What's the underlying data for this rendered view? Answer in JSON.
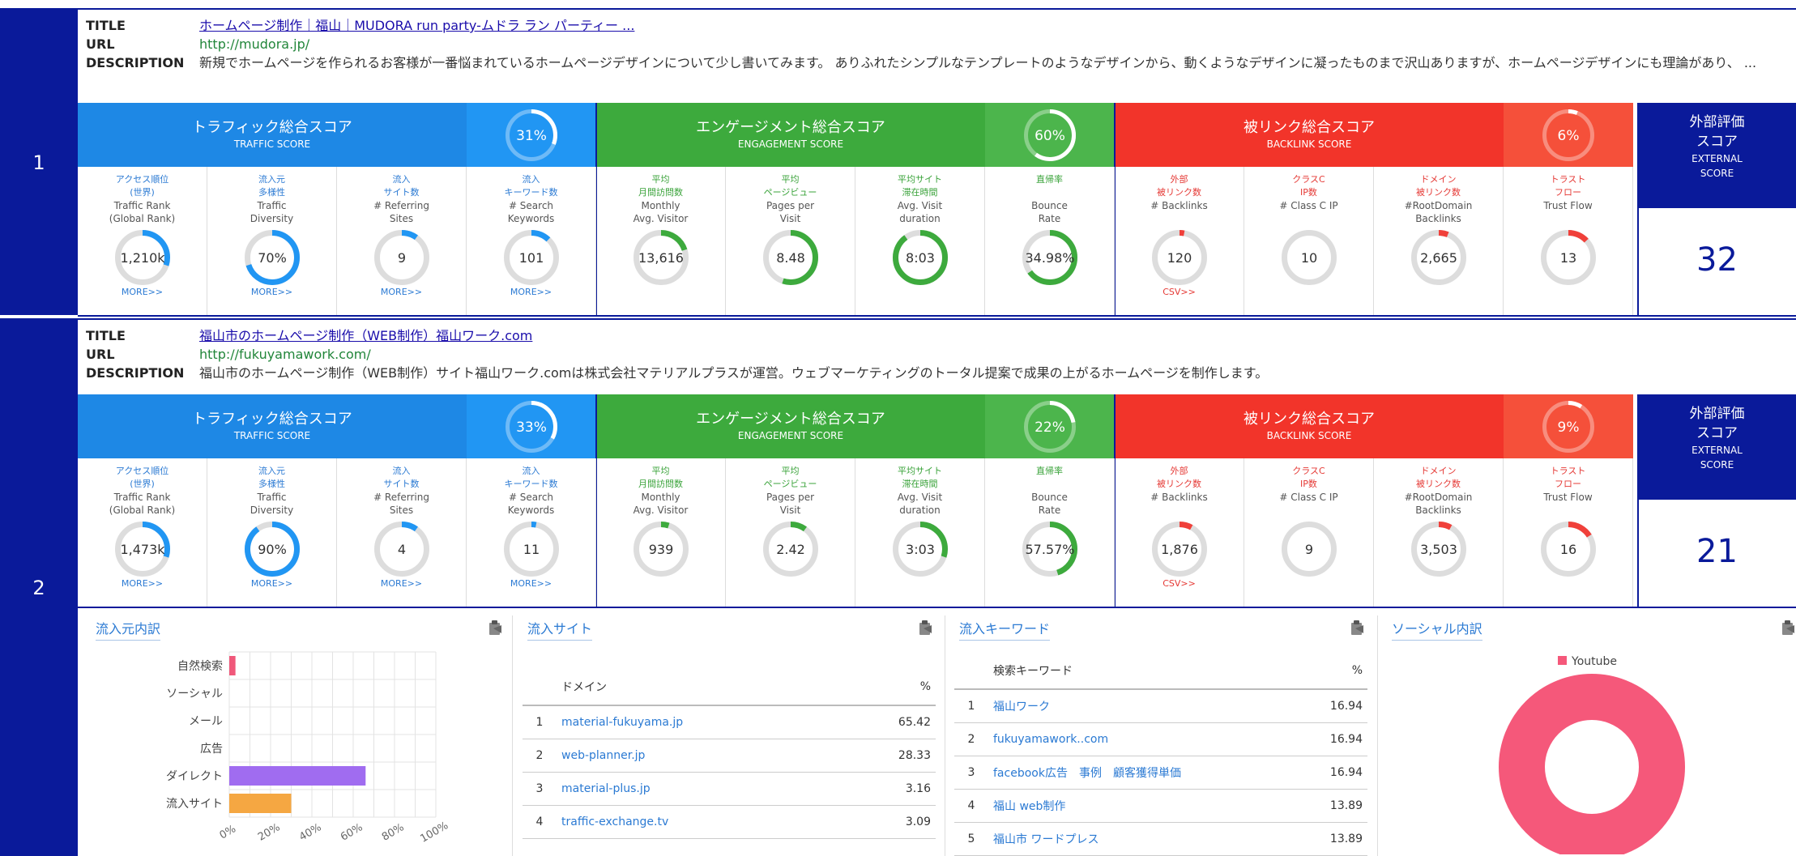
{
  "labels": {
    "title": "TITLE",
    "url": "URL",
    "description": "DESCRIPTION",
    "more": "MORE>>",
    "csv": "CSV>>"
  },
  "bands": {
    "traffic": {
      "jp": "トラフィック総合スコア",
      "en": "TRAFFIC SCORE",
      "color": "#1e88e5",
      "gauge_color": "#2196f3"
    },
    "engagement": {
      "jp": "エンゲージメント総合スコア",
      "en": "ENGAGEMENT SCORE",
      "color": "#3daa3d",
      "gauge_color": "#4cb54c"
    },
    "backlink": {
      "jp": "被リンク総合スコア",
      "en": "BACKLINK SCORE",
      "color": "#f2342a",
      "gauge_color": "#f5503a"
    }
  },
  "metric_labels": [
    {
      "jp": "アクセス順位\n(世界)",
      "en": "Traffic Rank\n(Global Rank)",
      "group": "traffic"
    },
    {
      "jp": "流入元\n多様性",
      "en": "Traffic\nDiversity",
      "group": "traffic"
    },
    {
      "jp": "流入\nサイト数",
      "en": "# Referring\nSites",
      "group": "traffic"
    },
    {
      "jp": "流入\nキーワード数",
      "en": "# Search\nKeywords",
      "group": "traffic"
    },
    {
      "jp": "平均\n月間訪問数",
      "en": "Monthly\nAvg. Visitor",
      "group": "engagement"
    },
    {
      "jp": "平均\nページビュー",
      "en": "Pages per\nVisit",
      "group": "engagement"
    },
    {
      "jp": "平均サイト\n滞在時間",
      "en": "Avg. Visit\nduration",
      "group": "engagement"
    },
    {
      "jp": "直帰率",
      "en": "Bounce\nRate",
      "group": "engagement"
    },
    {
      "jp": "外部\n被リンク数",
      "en": "# Backlinks",
      "group": "backlink"
    },
    {
      "jp": "クラスC\nIP数",
      "en": "# Class C IP",
      "group": "backlink"
    },
    {
      "jp": "ドメイン\n被リンク数",
      "en": "#RootDomain\nBacklinks",
      "group": "backlink"
    },
    {
      "jp": "トラスト\nフロー",
      "en": "Trust Flow",
      "group": "backlink"
    }
  ],
  "external": {
    "jp1": "外部評価",
    "jp2": "スコア",
    "en1": "EXTERNAL",
    "en2": "SCORE"
  },
  "sites": [
    {
      "rank": "1",
      "title": "ホームページ制作｜福山｜MUDORA run party-ムドラ ラン パーティー ...",
      "url": "http://mudora.jp/",
      "description": "新規でホームページを作られるお客様が一番悩まれているホームページデザインについて少し書いてみます。 ありふれたシンプルなテンプレートのようなデザインから、動くようなデザインに凝ったものまで沢山ありますが、ホームページデザインにも理論があり、 ...",
      "traffic_score": "31%",
      "traffic_pct": 31,
      "engagement_score": "60%",
      "engagement_pct": 60,
      "backlink_score": "6%",
      "backlink_pct": 6,
      "metrics": [
        {
          "value": "1,210k",
          "fill": 0.3,
          "more": true
        },
        {
          "value": "70%",
          "fill": 0.7,
          "more": true
        },
        {
          "value": "9",
          "fill": 0.1,
          "more": true
        },
        {
          "value": "101",
          "fill": 0.12,
          "more": true
        },
        {
          "value": "13,616",
          "fill": 0.2
        },
        {
          "value": "8.48",
          "fill": 0.55
        },
        {
          "value": "8:03",
          "fill": 0.9
        },
        {
          "value": "34.98%",
          "fill": 0.65
        },
        {
          "value": "120",
          "fill": 0.03,
          "csv": true
        },
        {
          "value": "10",
          "fill": 0.0
        },
        {
          "value": "2,665",
          "fill": 0.06
        },
        {
          "value": "13",
          "fill": 0.13
        }
      ],
      "external_score": "32"
    },
    {
      "rank": "2",
      "title": "福山市のホームページ制作（WEB制作）福山ワーク.com",
      "url": "http://fukuyamawork.com/",
      "description": "福山市のホームページ制作（WEB制作）サイト福山ワーク.comは株式会社マテリアルプラスが運営。ウェブマーケティングのトータル提案で成果の上がるホームページを制作します。",
      "traffic_score": "33%",
      "traffic_pct": 33,
      "engagement_score": "22%",
      "engagement_pct": 22,
      "backlink_score": "9%",
      "backlink_pct": 9,
      "metrics": [
        {
          "value": "1,473k",
          "fill": 0.3,
          "more": true
        },
        {
          "value": "90%",
          "fill": 0.9,
          "more": true
        },
        {
          "value": "4",
          "fill": 0.1,
          "more": true
        },
        {
          "value": "11",
          "fill": 0.03,
          "more": true
        },
        {
          "value": "939",
          "fill": 0.05
        },
        {
          "value": "2.42",
          "fill": 0.1
        },
        {
          "value": "3:03",
          "fill": 0.3
        },
        {
          "value": "57.57%",
          "fill": 0.45
        },
        {
          "value": "1,876",
          "fill": 0.08,
          "csv": true
        },
        {
          "value": "9",
          "fill": 0.0
        },
        {
          "value": "3,503",
          "fill": 0.08
        },
        {
          "value": "16",
          "fill": 0.16
        }
      ],
      "external_score": "21"
    }
  ],
  "panels": {
    "inflow": {
      "title": "流入元内訳"
    },
    "sites": {
      "title": "流入サイト",
      "col_domain": "ドメイン",
      "col_pct": "%",
      "rows": [
        {
          "n": "1",
          "domain": "material-fukuyama.jp",
          "pct": "65.42"
        },
        {
          "n": "2",
          "domain": "web-planner.jp",
          "pct": "28.33"
        },
        {
          "n": "3",
          "domain": "material-plus.jp",
          "pct": "3.16"
        },
        {
          "n": "4",
          "domain": "traffic-exchange.tv",
          "pct": "3.09"
        }
      ]
    },
    "keywords": {
      "title": "流入キーワード",
      "col_kw": "検索キーワード",
      "col_pct": "%",
      "rows": [
        {
          "n": "1",
          "kw": "福山ワーク",
          "pct": "16.94"
        },
        {
          "n": "2",
          "kw": "fukuyamawork..com",
          "pct": "16.94"
        },
        {
          "n": "3",
          "kw": "facebook広告　事例　顧客獲得単価",
          "pct": "16.94"
        },
        {
          "n": "4",
          "kw": "福山 web制作",
          "pct": "13.89"
        },
        {
          "n": "5",
          "kw": "福山市 ワードプレス",
          "pct": "13.89"
        }
      ]
    },
    "social": {
      "title": "ソーシャル内訳"
    }
  },
  "chart_data": [
    {
      "type": "bar",
      "orientation": "horizontal",
      "categories": [
        "自然検索",
        "ソーシャル",
        "メール",
        "広告",
        "ダイレクト",
        "流入サイト"
      ],
      "values": [
        3,
        0,
        0,
        0,
        66,
        30
      ],
      "colors": [
        "#f0587a",
        "#cccccc",
        "#cccccc",
        "#cccccc",
        "#a06cf0",
        "#f5a742"
      ],
      "xlim": [
        0,
        100
      ],
      "xticks": [
        "0%",
        "20%",
        "40%",
        "60%",
        "80%",
        "100%"
      ],
      "grid": true
    },
    {
      "type": "pie",
      "donut": true,
      "categories": [
        "Youtube"
      ],
      "values": [
        100
      ],
      "colors": [
        "#f5587a"
      ],
      "legend": "top"
    }
  ]
}
